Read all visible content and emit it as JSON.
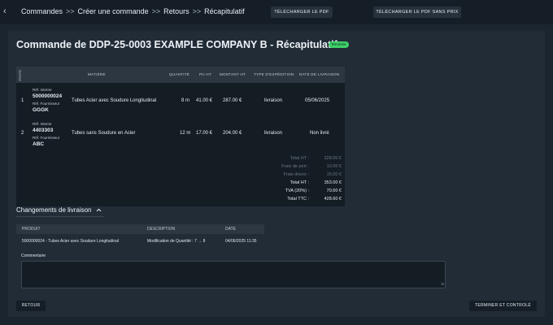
{
  "breadcrumb": {
    "back_icon": "chevron-left-icon",
    "items": [
      "Commandes",
      "Créer une commande",
      "Retours",
      "Récapitulatif"
    ],
    "separator": ">>"
  },
  "header": {
    "download_pdf": "TÉLÉCHARGER LE PDF",
    "download_pdf_no_price": "TÉLÉCHARGER LE PDF SANS PRIX"
  },
  "page": {
    "title": "Commande de DDP-25-0003 EXAMPLE COMPANY B - Récapitulatif",
    "status_badge": "Terminée"
  },
  "table": {
    "headers": {
      "poste": "POSTE",
      "matiere": "MATIÈRE",
      "quantite": "QUANTITÉ",
      "pu_ht": "PU HT",
      "montant_ht": "MONTANT HT",
      "type_expedition": "TYPE D'EXPÉDITION",
      "date_livraison": "DATE DE LIVRAISON"
    },
    "rows": [
      {
        "poste": "1",
        "ref_interne_label": "Réf. Interne",
        "ref_interne": "5000000024",
        "ref_fournisseur_label": "Réf. Fournisseur",
        "ref_fournisseur": "GGGK",
        "matiere": "Tubes Acier avec Soudure Longitudinal",
        "quantite": "8 m",
        "pu_ht": "41.00 €",
        "montant_ht": "287.00 €",
        "type_expedition": "livraison",
        "date_livraison": "05/06/2025"
      },
      {
        "poste": "2",
        "ref_interne_label": "Réf. Interne",
        "ref_interne": "4403303",
        "ref_fournisseur_label": "Réf. Fournisseur",
        "ref_fournisseur": "ABC",
        "matiere": "Tubes sans Soudure en Acier",
        "quantite": "12 m",
        "pu_ht": "17.00 €",
        "montant_ht": "204.00 €",
        "type_expedition": "livraison",
        "date_livraison": "Non livré"
      }
    ],
    "totals": [
      {
        "label": "Total HT :",
        "value": "328.00 €"
      },
      {
        "label": "Frais de port :",
        "value": "10.00 €"
      },
      {
        "label": "Frais divers :",
        "value": "15.00 €"
      },
      {
        "label": "Total HT :",
        "value": "353.00 €"
      },
      {
        "label": "TVA (20%) :",
        "value": "70.60 €"
      },
      {
        "label": "Total TTC :",
        "value": "428.60 €"
      }
    ]
  },
  "changes": {
    "title": "Changements de livraison",
    "toggle_icon": "chevron-up-icon",
    "headers": {
      "produit": "PRODUIT",
      "description": "DESCRIPTION",
      "date": "DATE"
    },
    "rows": [
      {
        "produit": "5000000024 - Tubes Acier avec Soudure Longitudinal",
        "description": "Modification de Quantité : 7 → 8",
        "date": "04/06/2025 11:35"
      }
    ]
  },
  "comment": {
    "label": "Commentaire",
    "value": ""
  },
  "footer": {
    "back": "RETOUR",
    "finish": "TERMINER ET CONTROLÉ"
  }
}
